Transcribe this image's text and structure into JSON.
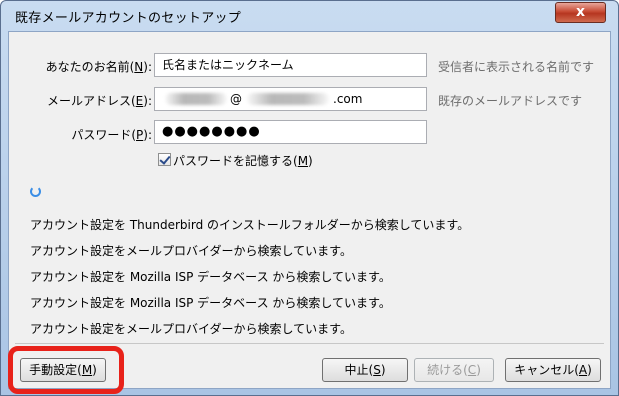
{
  "window": {
    "title": "既存メールアカウントのセットアップ",
    "close_glyph": "x"
  },
  "form": {
    "name_label_prefix": "あなたのお名前(",
    "name_label_key": "N",
    "name_label_suffix": "):",
    "name_value": "氏名またはニックネーム",
    "name_hint": "受信者に表示される名前です",
    "email_label_prefix": "メールアドレス(",
    "email_label_key": "E",
    "email_label_suffix": "):",
    "email_at": "@",
    "email_domain_suffix": ".com",
    "email_hint": "既存のメールアドレスです",
    "password_label_prefix": "パスワード(",
    "password_label_key": "P",
    "password_label_suffix": "):",
    "password_masked": "●●●●●●●●",
    "remember_prefix": "パスワードを記憶する(",
    "remember_key": "M",
    "remember_suffix": ")",
    "remember_checked": true
  },
  "status": {
    "lines": [
      "アカウント設定を Thunderbird のインストールフォルダーから検索しています。",
      "アカウント設定をメールプロバイダーから検索しています。",
      "アカウント設定を Mozilla ISP データベース から検索しています。",
      "アカウント設定を Mozilla ISP データベース から検索しています。",
      "アカウント設定をメールプロバイダーから検索しています。"
    ]
  },
  "buttons": {
    "manual_prefix": "手動設定(",
    "manual_key": "M",
    "manual_suffix": ")",
    "stop_prefix": "中止(",
    "stop_key": "S",
    "stop_suffix": ")",
    "continue_prefix": "続ける(",
    "continue_key": "C",
    "continue_suffix": ")",
    "cancel_prefix": "キャンセル(",
    "cancel_key": "A",
    "cancel_suffix": ")"
  },
  "colors": {
    "highlight": "#e8221a",
    "spinner": "#3b8ee6"
  }
}
